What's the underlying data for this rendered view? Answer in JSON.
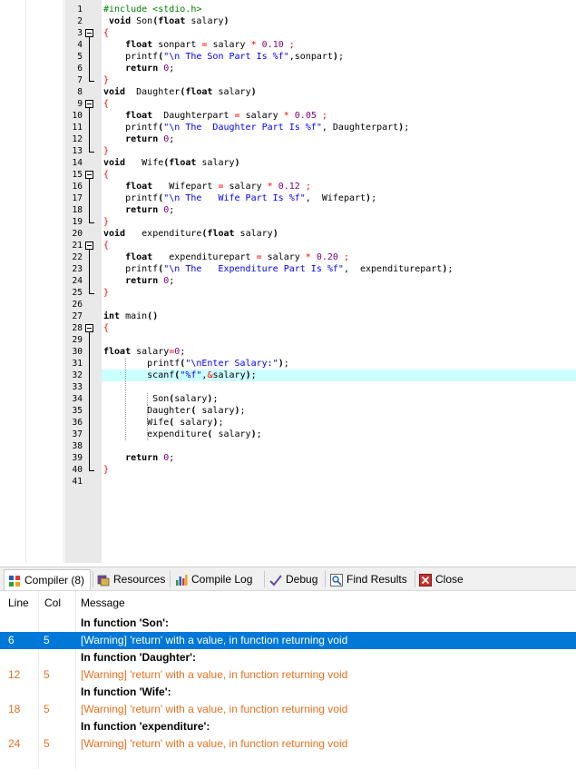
{
  "editor": {
    "line_numbers": [
      "1",
      "2",
      "3",
      "4",
      "5",
      "6",
      "7",
      "8",
      "9",
      "10",
      "11",
      "12",
      "13",
      "14",
      "15",
      "16",
      "17",
      "18",
      "19",
      "20",
      "21",
      "22",
      "23",
      "24",
      "25",
      "26",
      "27",
      "28",
      "29",
      "30",
      "31",
      "32",
      "33",
      "34",
      "35",
      "36",
      "37",
      "38",
      "39",
      "40",
      "41"
    ],
    "lines": [
      {
        "n": 1,
        "indent": "",
        "html": "<span class='pp'>#include &lt;stdio.h&gt;</span>"
      },
      {
        "n": 2,
        "indent": " ",
        "html": "<span class='kw'>void</span> Son<span class='kw'>(</span><span class='kw'>float</span> salary<span class='kw'>)</span>"
      },
      {
        "n": 3,
        "indent": "",
        "html": "<span class='br'>{</span>"
      },
      {
        "n": 4,
        "indent": "    ",
        "html": "<span class='kw'>float</span> sonpart <span class='op'>=</span> salary <span class='op'>*</span> <span class='num'>0.10</span> <span class='op'>;</span>"
      },
      {
        "n": 5,
        "indent": "    ",
        "html": "printf<span class='kw'>(</span><span class='str'>\"\\n The Son Part Is %f\"</span>,sonpart<span class='kw'>)</span>;"
      },
      {
        "n": 6,
        "indent": "    ",
        "html": "<span class='kw'>return</span> <span class='num'>0</span>;"
      },
      {
        "n": 7,
        "indent": "",
        "html": "<span class='br'>}</span>"
      },
      {
        "n": 8,
        "indent": "",
        "html": "<span class='kw'>void</span>  Daughter<span class='kw'>(</span><span class='kw'>float</span> salary<span class='kw'>)</span>"
      },
      {
        "n": 9,
        "indent": "",
        "html": "<span class='br'>{</span>"
      },
      {
        "n": 10,
        "indent": "    ",
        "html": "<span class='kw'>float</span>  Daughterpart <span class='op'>=</span> salary <span class='op'>*</span> <span class='num'>0.05</span> <span class='op'>;</span>"
      },
      {
        "n": 11,
        "indent": "    ",
        "html": "printf<span class='kw'>(</span><span class='str'>\"\\n The  Daughter Part Is %f\"</span>, Daughterpart<span class='kw'>)</span>;"
      },
      {
        "n": 12,
        "indent": "    ",
        "html": "<span class='kw'>return</span> <span class='num'>0</span>;"
      },
      {
        "n": 13,
        "indent": "",
        "html": "<span class='br'>}</span>"
      },
      {
        "n": 14,
        "indent": "",
        "html": "<span class='kw'>void</span>   Wife<span class='kw'>(</span><span class='kw'>float</span> salary<span class='kw'>)</span>"
      },
      {
        "n": 15,
        "indent": "",
        "html": "<span class='br'>{</span>"
      },
      {
        "n": 16,
        "indent": "    ",
        "html": "<span class='kw'>float</span>   Wifepart <span class='op'>=</span> salary <span class='op'>*</span> <span class='num'>0.12</span> <span class='op'>;</span>"
      },
      {
        "n": 17,
        "indent": "    ",
        "html": "printf<span class='kw'>(</span><span class='str'>\"\\n The   Wife Part Is %f\"</span>,  Wifepart<span class='kw'>)</span>;"
      },
      {
        "n": 18,
        "indent": "    ",
        "html": "<span class='kw'>return</span> <span class='num'>0</span>;"
      },
      {
        "n": 19,
        "indent": "",
        "html": "<span class='br'>}</span>"
      },
      {
        "n": 20,
        "indent": "",
        "html": "<span class='kw'>void</span>   expenditure<span class='kw'>(</span><span class='kw'>float</span> salary<span class='kw'>)</span>"
      },
      {
        "n": 21,
        "indent": "",
        "html": "<span class='br'>{</span>"
      },
      {
        "n": 22,
        "indent": "    ",
        "html": "<span class='kw'>float</span>   expenditurepart <span class='op'>=</span> salary <span class='op'>*</span> <span class='num'>0.20</span> <span class='op'>;</span>"
      },
      {
        "n": 23,
        "indent": "    ",
        "html": "printf<span class='kw'>(</span><span class='str'>\"\\n The   Expenditure Part Is %f\"</span>,  expenditurepart<span class='kw'>)</span>;"
      },
      {
        "n": 24,
        "indent": "    ",
        "html": "<span class='kw'>return</span> <span class='num'>0</span>;"
      },
      {
        "n": 25,
        "indent": "",
        "html": "<span class='br'>}</span>"
      },
      {
        "n": 26,
        "indent": "",
        "html": ""
      },
      {
        "n": 27,
        "indent": "",
        "html": "<span class='kw'>int</span> main<span class='kw'>()</span>"
      },
      {
        "n": 28,
        "indent": "",
        "html": "<span class='br'>{</span>"
      },
      {
        "n": 29,
        "indent": "",
        "html": ""
      },
      {
        "n": 30,
        "indent": "",
        "html": "<span class='kw'>float</span> salary<span class='op'>=</span><span class='num'>0</span>;"
      },
      {
        "n": 31,
        "indent": "        ",
        "html": "printf<span class='kw'>(</span><span class='str'>\"\\nEnter Salary:\"</span><span class='kw'>)</span>;"
      },
      {
        "n": 32,
        "indent": "        ",
        "html": "scanf<span class='kw'>(</span><span class='str'>\"%f\"</span>,<span class='op'>&amp;</span>salary<span class='kw'>)</span>;"
      },
      {
        "n": 33,
        "indent": "",
        "html": ""
      },
      {
        "n": 34,
        "indent": "         ",
        "html": "Son<span class='kw'>(</span>salary<span class='kw'>)</span>;"
      },
      {
        "n": 35,
        "indent": "        ",
        "html": "Daughter<span class='kw'>(</span> salary<span class='kw'>)</span>;"
      },
      {
        "n": 36,
        "indent": "        ",
        "html": "Wife<span class='kw'>(</span> salary<span class='kw'>)</span>;"
      },
      {
        "n": 37,
        "indent": "        ",
        "html": "expenditure<span class='kw'>(</span> salary<span class='kw'>)</span>;"
      },
      {
        "n": 38,
        "indent": "",
        "html": ""
      },
      {
        "n": 39,
        "indent": "    ",
        "html": "<span class='kw'>return</span> <span class='num'>0</span>;"
      },
      {
        "n": 40,
        "indent": "",
        "html": "<span class='br'>}</span>"
      },
      {
        "n": 41,
        "indent": "",
        "html": ""
      }
    ],
    "current_line": 32
  },
  "panel": {
    "tabs": [
      {
        "label": "Compiler (8)",
        "icon": "compiler-icon",
        "active": true
      },
      {
        "label": "Resources",
        "icon": "resources-icon",
        "active": false
      },
      {
        "label": "Compile Log",
        "icon": "compile-log-icon",
        "active": false
      },
      {
        "label": "Debug",
        "icon": "debug-icon",
        "active": false
      },
      {
        "label": "Find Results",
        "icon": "find-results-icon",
        "active": false
      },
      {
        "label": "Close",
        "icon": "close-icon",
        "active": false
      }
    ],
    "columns": {
      "line": "Line",
      "col": "Col",
      "message": "Message"
    },
    "rows": [
      {
        "line": "",
        "col": "",
        "message": "In function 'Son':",
        "kind": "func"
      },
      {
        "line": "6",
        "col": "5",
        "message": "[Warning] 'return' with a value, in function returning void",
        "kind": "sel"
      },
      {
        "line": "",
        "col": "",
        "message": "In function 'Daughter':",
        "kind": "func"
      },
      {
        "line": "12",
        "col": "5",
        "message": "[Warning] 'return' with a value, in function returning void",
        "kind": "warn"
      },
      {
        "line": "",
        "col": "",
        "message": "In function 'Wife':",
        "kind": "func"
      },
      {
        "line": "18",
        "col": "5",
        "message": "[Warning] 'return' with a value, in function returning void",
        "kind": "warn"
      },
      {
        "line": "",
        "col": "",
        "message": "In function 'expenditure':",
        "kind": "func"
      },
      {
        "line": "24",
        "col": "5",
        "message": "[Warning] 'return' with a value, in function returning void",
        "kind": "warn"
      }
    ]
  }
}
